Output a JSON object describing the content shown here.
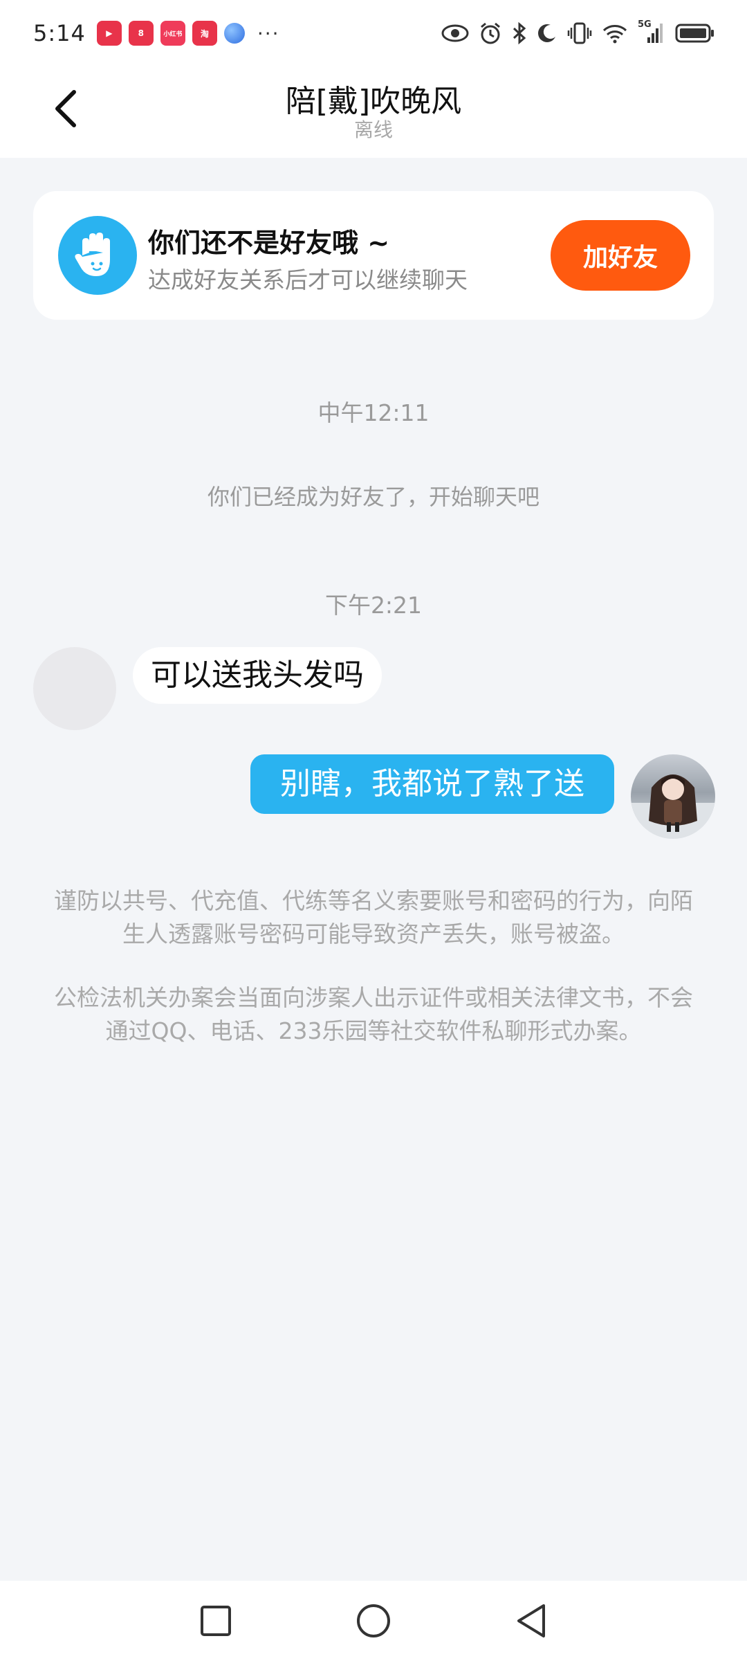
{
  "status_bar": {
    "time": "5:14",
    "app_icons": [
      "video-app-icon",
      "kuaishou-icon",
      "xiaohongshu-icon",
      "taobao-icon",
      "browser-icon"
    ],
    "app_icon_labels": [
      "▶",
      "8",
      "小红书",
      "淘"
    ],
    "more": "···",
    "network": "5G"
  },
  "header": {
    "title": "陪[戴]吹晚风",
    "subtitle": "离线"
  },
  "friend_banner": {
    "title": "你们还不是好友哦 ~",
    "description": "达成好友关系后才可以继续聊天",
    "button_label": "加好友"
  },
  "chat": {
    "timestamp_1": "中午12:11",
    "system_message": "你们已经成为好友了，开始聊天吧",
    "timestamp_2": "下午2:21",
    "incoming_message": "可以送我头发吗",
    "outgoing_message": "别瞎，我都说了熟了送"
  },
  "warnings": {
    "warning_1": "谨防以共号、代充值、代练等名义索要账号和密码的行为，向陌生人透露账号密码可能导致资产丢失，账号被盗。",
    "warning_2": "公检法机关办案会当面向涉案人出示证件或相关法律文书，不会通过QQ、电话、233乐园等社交软件私聊形式办案。"
  },
  "colors": {
    "accent_blue": "#2ab3f0",
    "add_friend_orange": "#ff5a0f",
    "background": "#f3f5f8"
  }
}
